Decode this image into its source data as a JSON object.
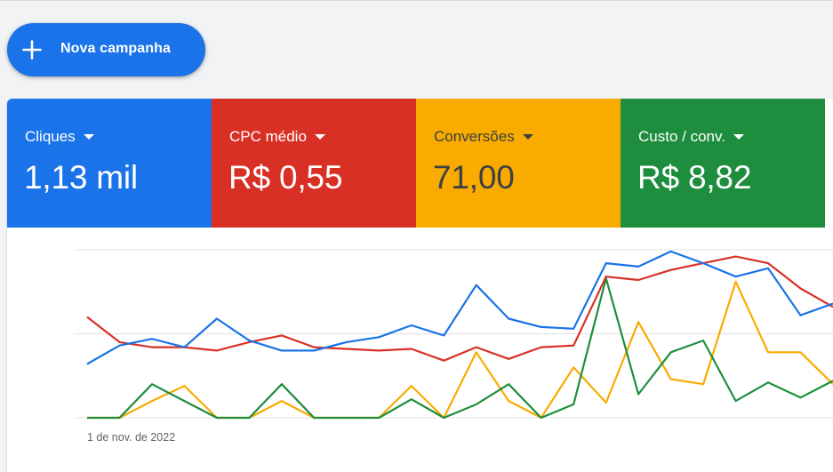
{
  "new_campaign": {
    "label": "Nova campanha",
    "icon": "plus-icon"
  },
  "metrics": [
    {
      "key": "clicks",
      "title": "Cliques",
      "value": "1,13 mil",
      "color": "#1a73e8",
      "text_color": "#ffffff"
    },
    {
      "key": "avg_cpc",
      "title": "CPC médio",
      "value": "R$ 0,55",
      "color": "#d93025",
      "text_color": "#ffffff"
    },
    {
      "key": "conversions",
      "title": "Conversões",
      "value": "71,00",
      "color": "#f9ab00",
      "text_color": "#3c4043"
    },
    {
      "key": "cost_per_conv",
      "title": "Custo / conv.",
      "value": "R$ 8,82",
      "color": "#1e8e3e",
      "text_color": "#ffffff"
    }
  ],
  "chart_data": {
    "type": "line",
    "x_start_label": "1 de nov. de 2022",
    "ylim": [
      0,
      100
    ],
    "grid": true,
    "series": [
      {
        "key": "clicks",
        "color": "#1a73e8",
        "values": [
          32,
          43,
          47,
          42,
          59,
          46,
          40,
          40,
          45,
          48,
          55,
          49,
          79,
          59,
          54,
          53,
          92,
          90,
          99,
          92,
          84,
          89,
          61,
          68
        ]
      },
      {
        "key": "avg_cpc",
        "color": "#d93025",
        "values": [
          60,
          45,
          42,
          42,
          40,
          45,
          49,
          42,
          41,
          40,
          41,
          34,
          42,
          35,
          42,
          43,
          84,
          82,
          88,
          92,
          96,
          92,
          77,
          66
        ]
      },
      {
        "key": "conversions",
        "color": "#f9ab00",
        "values": [
          0,
          0,
          10,
          19,
          0,
          0,
          10,
          0,
          0,
          0,
          19,
          0,
          39,
          10,
          0,
          30,
          9,
          57,
          23,
          20,
          81,
          39,
          39,
          20
        ]
      },
      {
        "key": "cost_per_conv",
        "color": "#1e8e3e",
        "values": [
          0,
          0,
          20,
          10,
          0,
          0,
          20,
          0,
          0,
          0,
          11,
          0,
          8,
          20,
          0,
          8,
          83,
          14,
          39,
          46,
          10,
          21,
          12,
          22
        ]
      }
    ]
  }
}
